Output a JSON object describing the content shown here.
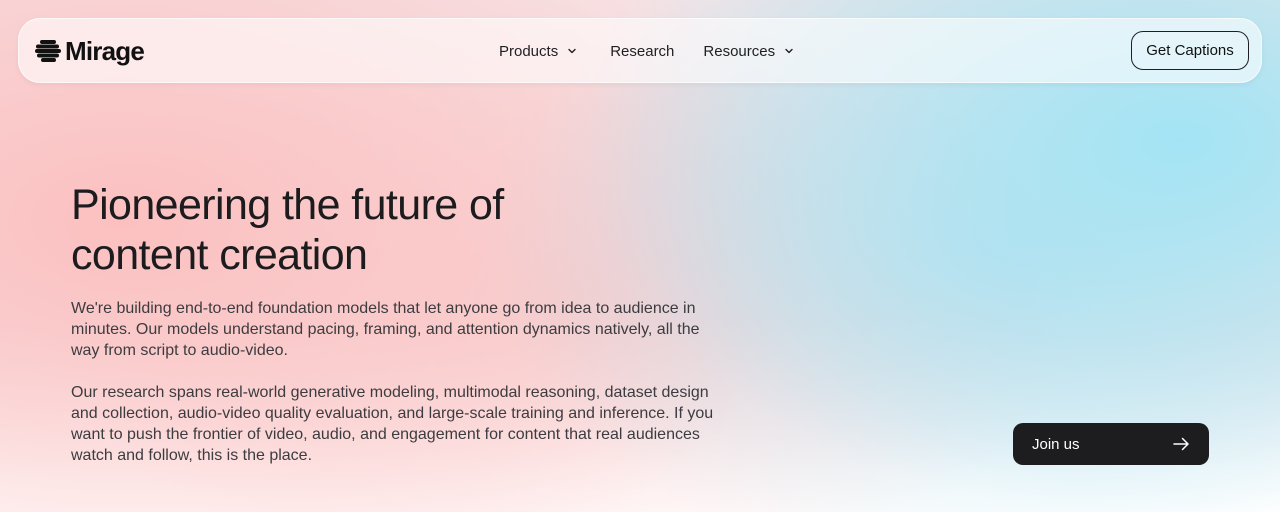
{
  "nav": {
    "brand": {
      "name": "Mirage",
      "icon": "mirage-logo-icon"
    },
    "links": [
      {
        "label": "Products",
        "has_dropdown": true,
        "icon": "chevron-down-icon"
      },
      {
        "label": "Research",
        "has_dropdown": false
      },
      {
        "label": "Resources",
        "has_dropdown": true,
        "icon": "chevron-down-icon"
      }
    ],
    "cta_label": "Get Captions"
  },
  "hero": {
    "title_line1": "Pioneering the future of",
    "title_line2": "content creation",
    "paragraph1": "We're building end-to-end foundation models that let anyone go from idea to audience in minutes. Our models understand pacing, framing, and attention dynamics natively, all the way from script to audio-video.",
    "paragraph2": "Our research spans real-world generative modeling, multimodal reasoning, dataset design and collection, audio-video quality evaluation, and large-scale training and inference. If you want to push the frontier of video, audio, and engagement for content that real audiences watch and follow, this is the place.",
    "join_label": "Join us",
    "join_icon": "arrow-right-icon"
  },
  "colors": {
    "text": "#1c1c1e",
    "button_dark": "#1d1d1f",
    "gradient_pink": "#fcbebe",
    "gradient_cyan": "#a0e4f5"
  }
}
